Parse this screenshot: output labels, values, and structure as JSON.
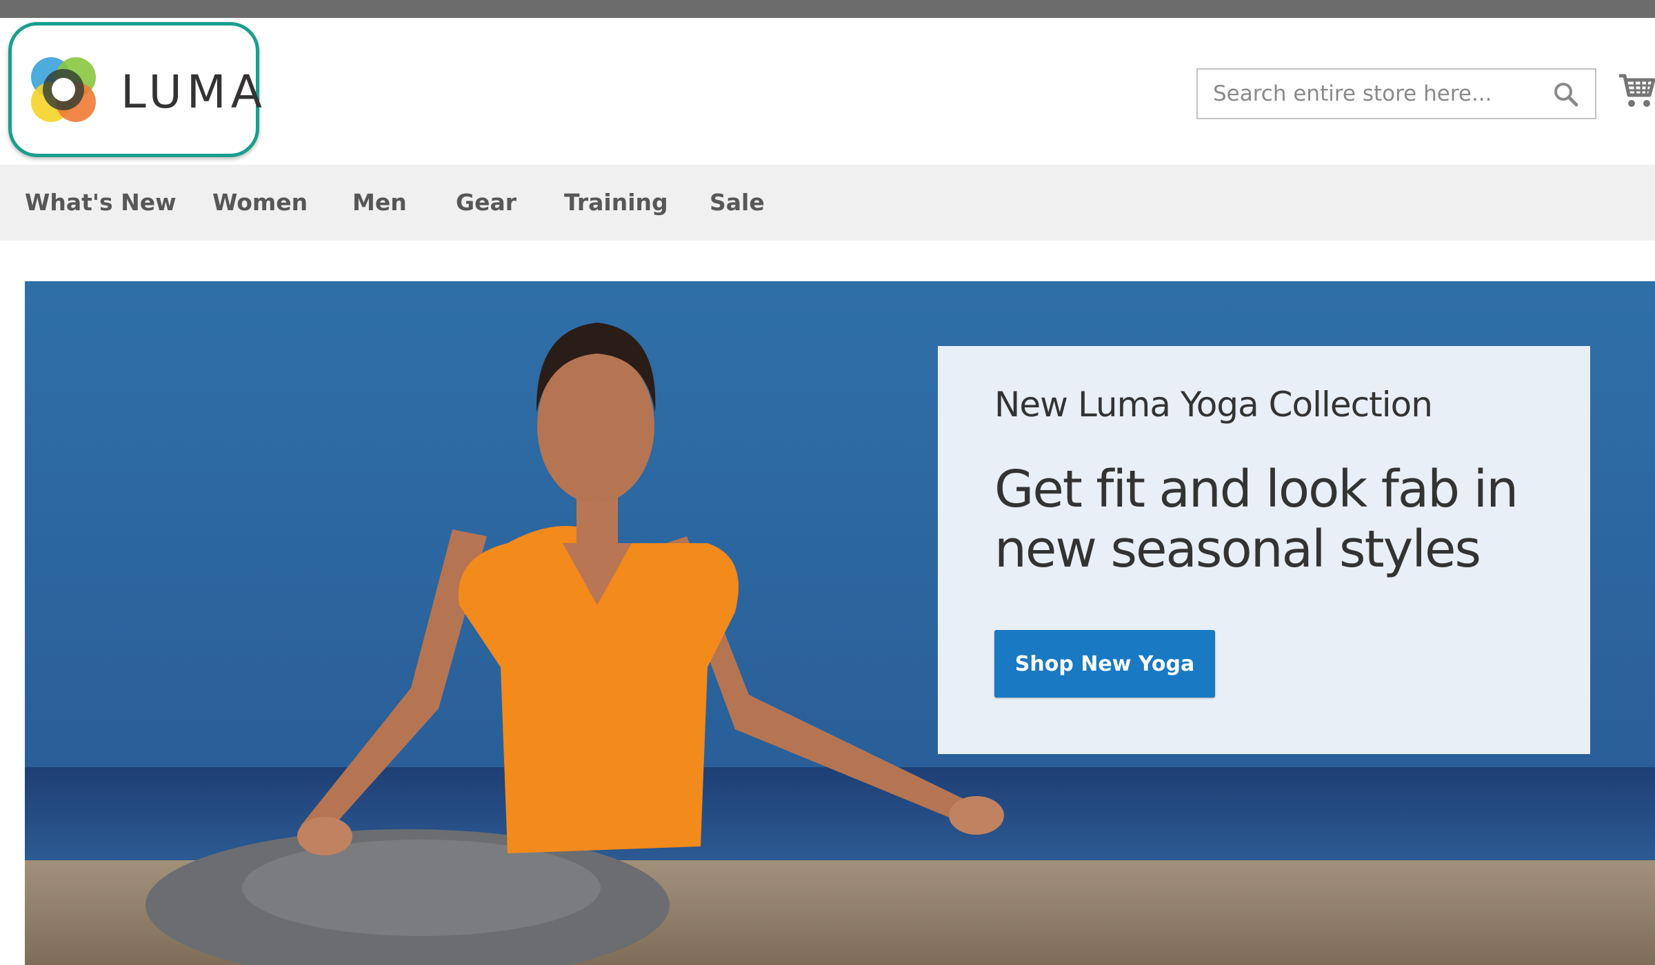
{
  "header": {
    "logo_text": "LUMA",
    "search": {
      "placeholder": "Search entire store here..."
    }
  },
  "nav": {
    "items": [
      {
        "label": "What's New"
      },
      {
        "label": "Women"
      },
      {
        "label": "Men"
      },
      {
        "label": "Gear"
      },
      {
        "label": "Training"
      },
      {
        "label": "Sale"
      }
    ]
  },
  "hero": {
    "subtitle": "New Luma Yoga Collection",
    "title_line1": "Get fit and look fab in",
    "title_line2": "new seasonal styles",
    "button_label": "Shop New Yoga"
  },
  "colors": {
    "topbar": "#6b6c6b",
    "logo_highlight": "#1a9f8c",
    "nav_background": "#f0f0f0",
    "button_blue": "#1979c3"
  }
}
